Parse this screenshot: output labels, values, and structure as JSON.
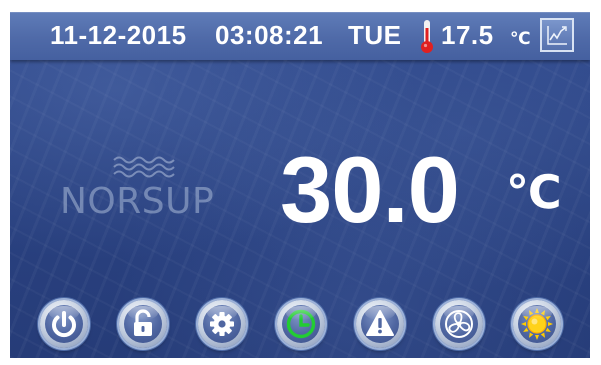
{
  "status_bar": {
    "date": "11-12-2015",
    "time": "03:08:21",
    "day": "TUE",
    "ambient_temperature": "17.5",
    "ambient_unit": "℃",
    "thermometer_icon": "thermometer-icon",
    "chart_icon": "trend-chart-icon"
  },
  "brand": {
    "name": "NORSUP",
    "logo_icon": "waves-logo-icon"
  },
  "main": {
    "setpoint_value": "30.0",
    "setpoint_unit": "℃"
  },
  "buttons": [
    {
      "icon": "power-icon"
    },
    {
      "icon": "unlock-icon"
    },
    {
      "icon": "gear-icon"
    },
    {
      "icon": "clock-icon",
      "active_color": "#22cc33"
    },
    {
      "icon": "warning-icon"
    },
    {
      "icon": "fan-icon"
    },
    {
      "icon": "sun-icon",
      "active_color": "#ffcc00"
    }
  ],
  "colors": {
    "background": "#2a4282",
    "status_bar": "#4f6aa8",
    "text": "#ffffff",
    "thermometer": "#e02020"
  }
}
